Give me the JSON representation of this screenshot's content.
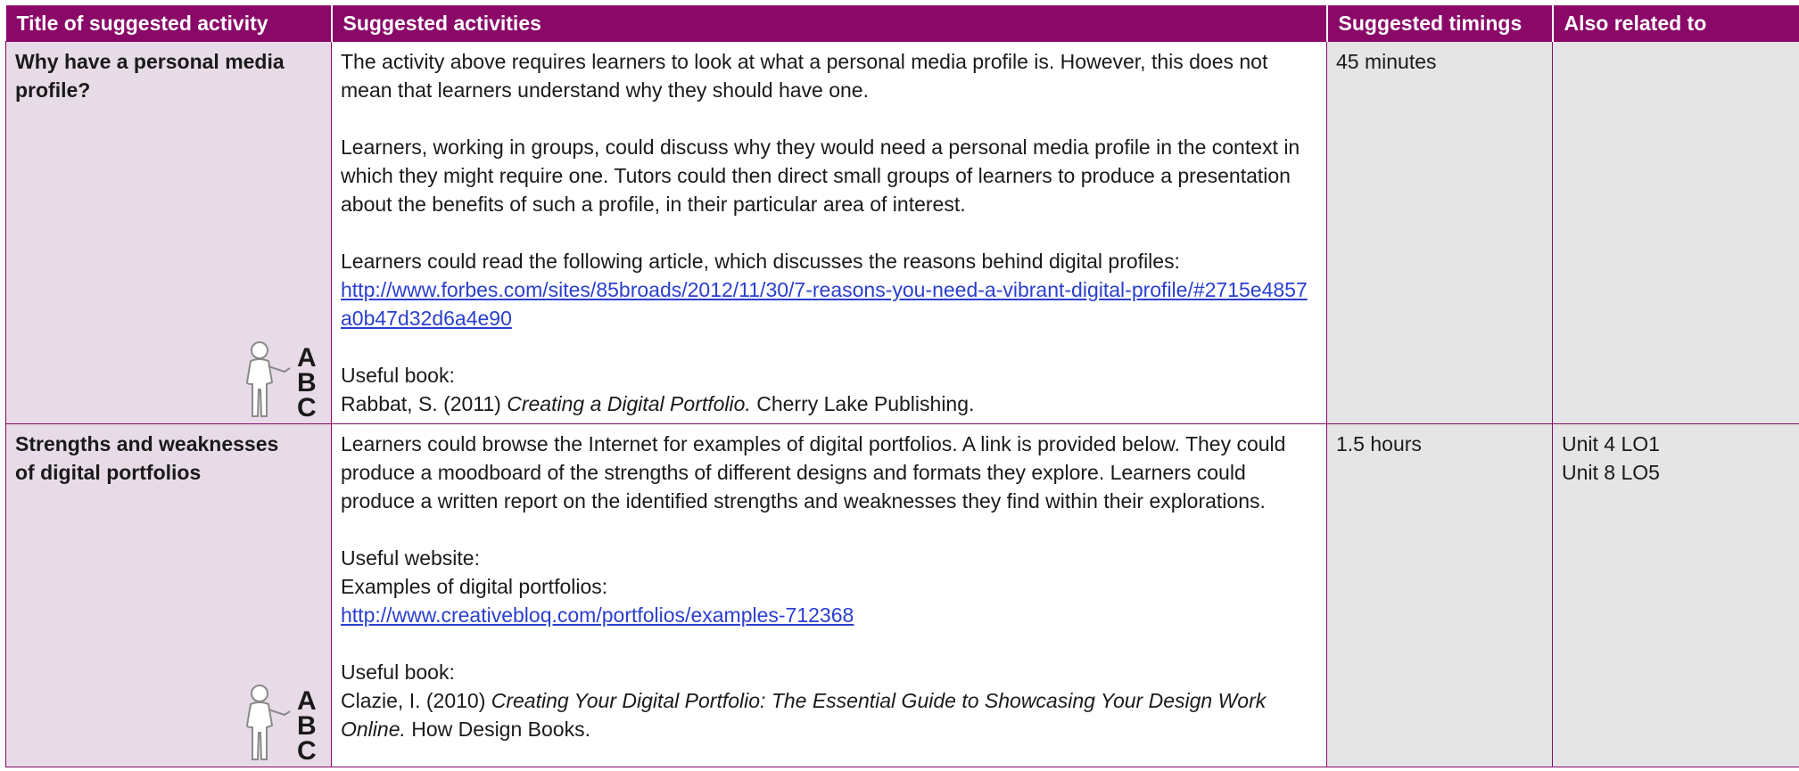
{
  "header": {
    "col1": "Title of suggested activity",
    "col2": "Suggested activities",
    "col3": "Suggested timings",
    "col4": "Also related to"
  },
  "rows": [
    {
      "title": "Why have a personal media profile?",
      "p1": "The activity above requires learners to look at what a personal media profile is. However, this does not mean that learners understand why they should have one.",
      "p2": "Learners, working in groups, could discuss why they would need a personal media profile in the context in which they might require one. Tutors could then direct small groups of learners to produce a presentation about the benefits of such a profile, in their particular area of interest.",
      "p3": "Learners could read the following article, which discusses the reasons behind digital profiles:",
      "link": "http://www.forbes.com/sites/85broads/2012/11/30/7-reasons-you-need-a-vibrant-digital-profile/#2715e4857a0b47d32d6a4e90",
      "book_label": "Useful book:",
      "book_prefix": "Rabbat, S. (2011)",
      "book_title": "Creating a Digital Portfolio.",
      "book_suffix": "Cherry Lake Publishing.",
      "timing": "45 minutes",
      "related": [],
      "icon": "abc-reading-figure-icon"
    },
    {
      "title": "Strengths and weaknesses of digital portfolios",
      "p1": "Learners could browse the Internet for examples of digital portfolios. A link is provided below. They could produce a moodboard of the strengths of different designs and formats they explore. Learners could produce a written report on the identified strengths and weaknesses they find within their explorations.",
      "website_label": "Useful website:",
      "website_desc": "Examples of digital portfolios:",
      "link": "http://www.creativebloq.com/portfolios/examples-712368",
      "book_label": "Useful book:",
      "book_prefix": "Clazie, I. (2010)",
      "book_title": "Creating Your Digital Portfolio: The Essential Guide to Showcasing Your Design Work Online.",
      "book_suffix": "How Design Books.",
      "timing": "1.5 hours",
      "related": [
        "Unit 4 LO1",
        "Unit 8 LO5"
      ],
      "icon": "abc-reading-figure-icon"
    }
  ],
  "colors": {
    "header_bg": "#8a0868",
    "title_bg": "#e8dbe8",
    "grey_bg": "#e5e5e6",
    "link": "#2a3fcf"
  }
}
